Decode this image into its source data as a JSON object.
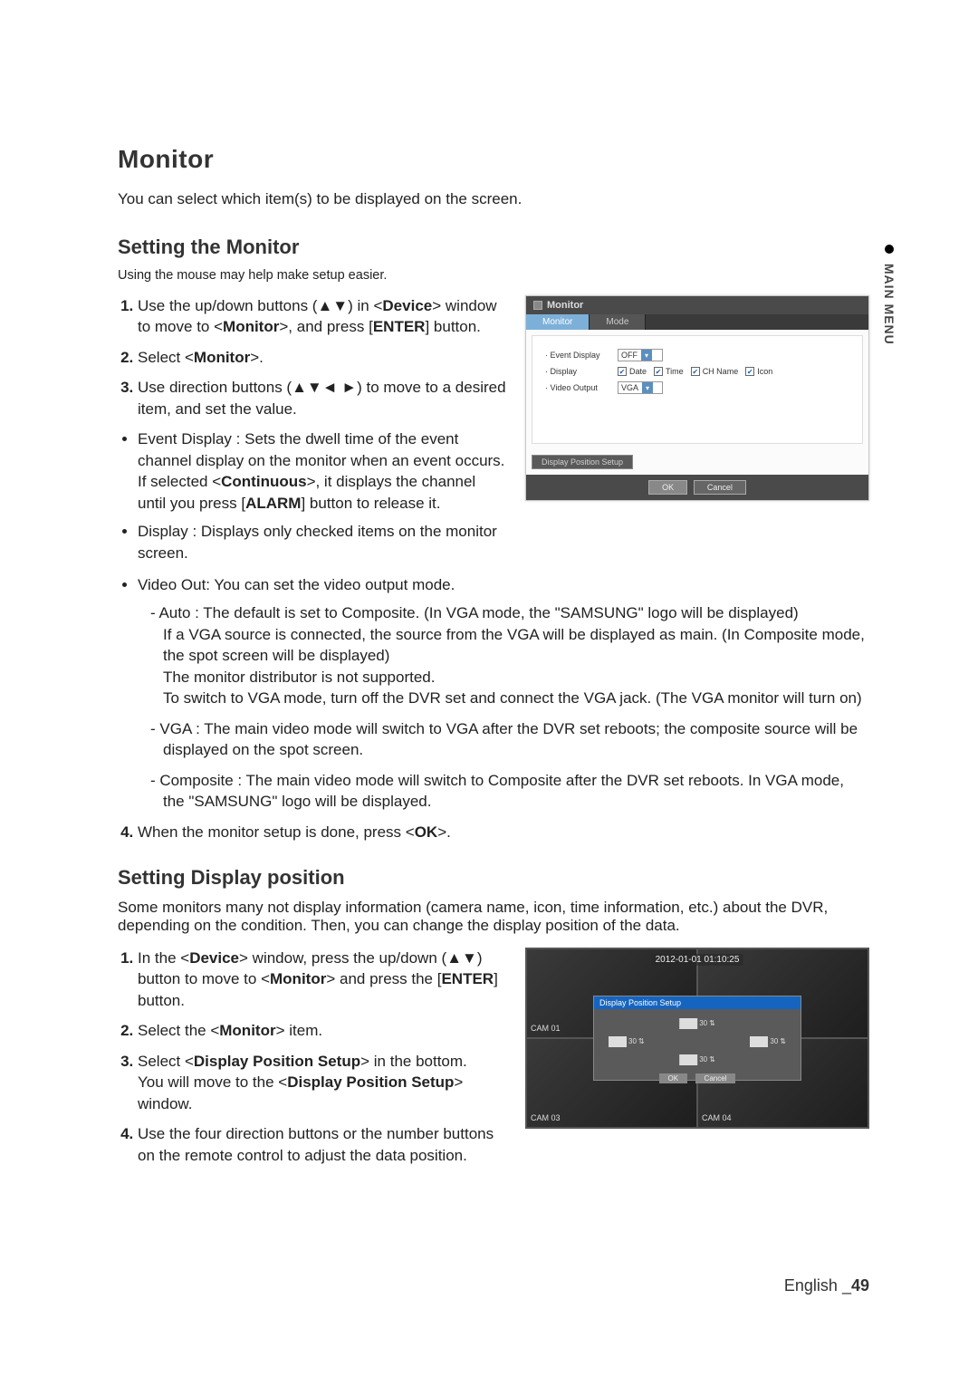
{
  "sideTab": {
    "label": "MAIN MENU"
  },
  "h1": "Monitor",
  "intro": "You can select which item(s) to be displayed on the screen.",
  "sec1": {
    "heading": "Setting the Monitor",
    "note": "Using the mouse may help make setup easier.",
    "steps": {
      "s1a": "Use the up/down buttons (",
      "s1b": ") in <",
      "s1c": "Device",
      "s1d": "> window to move to <",
      "s1e": "Monitor",
      "s1f": ">, and press [",
      "s1g": "ENTER",
      "s1h": "] button.",
      "s2a": "Select <",
      "s2b": "Monitor",
      "s2c": ">.",
      "s3a": "Use direction buttons (",
      "s3b": ") to move to a desired item, and set the value.",
      "s4a": "When the monitor setup is done, press <",
      "s4b": "OK",
      "s4c": ">."
    },
    "bullets": {
      "b1": "Event Display : Sets the dwell time of the event channel display on the monitor when an event occurs.",
      "b1_ext_a": "If selected <",
      "b1_ext_b": "Continuous",
      "b1_ext_c": ">, it displays the channel until you press [",
      "b1_ext_d": "ALARM",
      "b1_ext_e": "] button to release it.",
      "b2": "Display : Displays only checked items on the monitor screen.",
      "b3": "Video Out: You can set the video output mode.",
      "d1": "Auto : The default is set to Composite. (In VGA mode, the \"SAMSUNG\" logo will be displayed)\nIf a VGA source is connected, the source from the VGA will be displayed as main. (In Composite mode, the spot screen will be displayed)\nThe monitor distributor is not supported.\nTo switch to VGA mode, turn off the DVR set and connect the VGA jack. (The VGA monitor will turn on)",
      "d2": "VGA : The main video mode will switch to VGA after the DVR set reboots; the composite source will be displayed on the spot screen.",
      "d3": "Composite : The main video mode will switch to Composite after the DVR set reboots. In VGA mode, the \"SAMSUNG\" logo will be displayed."
    }
  },
  "sec2": {
    "heading": "Setting Display position",
    "intro": "Some monitors many not display information (camera name, icon, time information, etc.) about the DVR, depending on the condition. Then, you can change the display position of the data.",
    "steps": {
      "s1a": "In the <",
      "s1b": "Device",
      "s1c": "> window, press the up/down (",
      "s1d": ") button to move to <",
      "s1e": "Monitor",
      "s1f": "> and press the [",
      "s1g": "ENTER",
      "s1h": "] button.",
      "s2a": "Select the <",
      "s2b": "Monitor",
      "s2c": "> item.",
      "s3a": "Select <",
      "s3b": "Display Position Setup",
      "s3c": "> in the bottom.",
      "s3d": "You will move to the <",
      "s3e": "Display Position Setup",
      "s3f": "> window.",
      "s4": "Use the four direction buttons or the number buttons on the remote control to adjust the data position."
    }
  },
  "dialog": {
    "title": "Monitor",
    "tab1": "Monitor",
    "tab2": "Mode",
    "row_event": "· Event Display",
    "event_val": "OFF",
    "row_display": "· Display",
    "ck_date": "Date",
    "ck_time": "Time",
    "ck_ch": "CH Name",
    "ck_icon": "Icon",
    "row_video": "· Video Output",
    "video_val": "VGA",
    "bottom": "Display Position Setup",
    "ok": "OK",
    "cancel": "Cancel"
  },
  "dp": {
    "ts": "2012-01-01 01:10:25",
    "title": "Display Position Setup",
    "val": "30",
    "ok": "OK",
    "cancel": "Cancel",
    "cam1": "CAM 01",
    "cam3": "CAM 03",
    "cam4": "CAM 04"
  },
  "footer": {
    "lang": "English ",
    "sep": "_",
    "page": "49"
  },
  "glyphs": {
    "ud": "▲▼",
    "udlr": "▲▼◄ ►"
  }
}
